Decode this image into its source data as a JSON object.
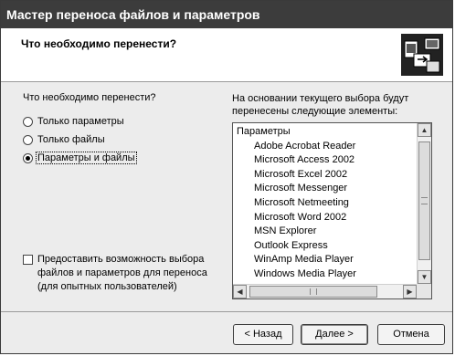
{
  "window": {
    "title": "Мастер переноса файлов и параметров"
  },
  "header": {
    "title": "Что необходимо перенести?",
    "icon": "transfer-wizard-icon"
  },
  "left": {
    "question": "Что необходимо перенести?",
    "options": [
      {
        "label": "Только параметры",
        "selected": false
      },
      {
        "label": "Только файлы",
        "selected": false
      },
      {
        "label": "Параметры и файлы",
        "selected": true
      }
    ],
    "custom_checkbox": {
      "line1": "Предоставить возможность выбора",
      "line2": "файлов и параметров для переноса",
      "line3": "(для опытных пользователей)",
      "checked": false
    }
  },
  "right": {
    "description_line1": "На основании текущего выбора будут",
    "description_line2": "перенесены следующие элементы:",
    "list": {
      "group": "Параметры",
      "items": [
        "Adobe Acrobat Reader",
        "Microsoft Access 2002",
        "Microsoft Excel 2002",
        "Microsoft Messenger",
        "Microsoft Netmeeting",
        "Microsoft Word 2002",
        "MSN Explorer",
        "Outlook Express",
        "WinAmp Media Player",
        "Windows Media Player"
      ]
    }
  },
  "buttons": {
    "back": "< Назад",
    "next": "Далее >",
    "cancel": "Отмена"
  }
}
